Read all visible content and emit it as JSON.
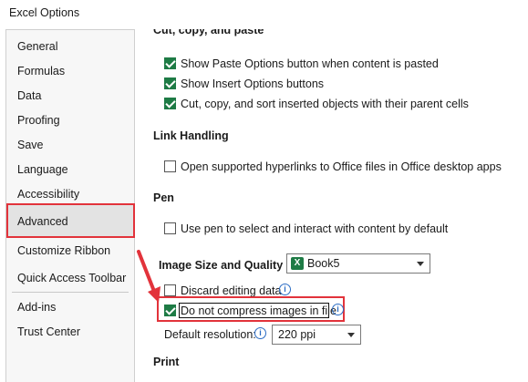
{
  "window": {
    "title": "Excel Options"
  },
  "sidebar": {
    "items": [
      {
        "label": "General"
      },
      {
        "label": "Formulas"
      },
      {
        "label": "Data"
      },
      {
        "label": "Proofing"
      },
      {
        "label": "Save"
      },
      {
        "label": "Language"
      },
      {
        "label": "Accessibility"
      },
      {
        "label": "Advanced",
        "selected": true
      },
      {
        "label": "Customize Ribbon"
      },
      {
        "label": "Quick Access Toolbar"
      },
      {
        "label": "Add-ins"
      },
      {
        "label": "Trust Center"
      }
    ]
  },
  "cut_copy_paste": {
    "title": "Cut, copy, and paste",
    "options": [
      {
        "label": "Show Paste Options button when content is pasted",
        "checked": true
      },
      {
        "label": "Show Insert Options buttons",
        "checked": true
      },
      {
        "label": "Cut, copy, and sort inserted objects with their parent cells",
        "checked": true
      }
    ]
  },
  "link_handling": {
    "title": "Link Handling",
    "options": [
      {
        "label": "Open supported hyperlinks to Office files in Office desktop apps",
        "checked": false
      }
    ]
  },
  "pen": {
    "title": "Pen",
    "options": [
      {
        "label": "Use pen to select and interact with content by default",
        "checked": false
      }
    ]
  },
  "image_size_quality": {
    "title": "Image Size and Quality",
    "workbook": "Book5",
    "discard_editing": {
      "label": "Discard editing data",
      "checked": false
    },
    "do_not_compress": {
      "label": "Do not compress images in file",
      "checked": true
    },
    "resolution_label": "Default resolution:",
    "resolution_value": "220 ppi"
  },
  "print": {
    "title": "Print"
  },
  "colors": {
    "highlight": "#e2333b",
    "check": "#1e7b45",
    "info": "#2b6cc4"
  }
}
